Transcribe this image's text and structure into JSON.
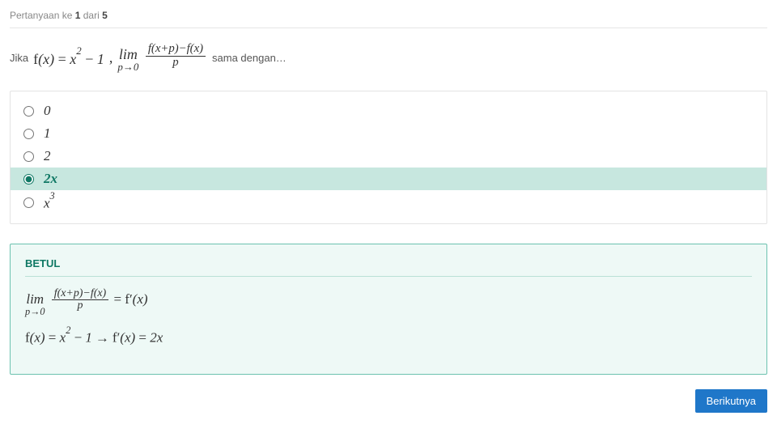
{
  "header": {
    "prefix": "Pertanyaan ke ",
    "current": "1",
    "sep": " dari ",
    "total": "5"
  },
  "question": {
    "lead": "Jika ",
    "expr_fx": "f(x) = x² − 1",
    "comma": ", ",
    "lim_word": "lim",
    "lim_sub": "p→0",
    "frac_num": "f(x+p)−f(x)",
    "frac_den": "p",
    "tail": " sama dengan…"
  },
  "options": [
    {
      "label": "0",
      "selected": false,
      "sup": ""
    },
    {
      "label": "1",
      "selected": false,
      "sup": ""
    },
    {
      "label": "2",
      "selected": false,
      "sup": ""
    },
    {
      "label": "2x",
      "selected": true,
      "sup": ""
    },
    {
      "label": "x",
      "selected": false,
      "sup": "3"
    }
  ],
  "feedback": {
    "title": "BETUL",
    "line1": {
      "lim_word": "lim",
      "lim_sub": "p→0",
      "frac_num": "f(x+p)−f(x)",
      "frac_den": "p",
      "eq": " = f′(x)"
    },
    "line2": "f(x) = x² − 1 → f′(x) = 2x"
  },
  "buttons": {
    "next": "Berikutnya"
  },
  "chart_data": {
    "type": "table",
    "question_number": 1,
    "total_questions": 5,
    "answer_options": [
      "0",
      "1",
      "2",
      "2x",
      "x^3"
    ],
    "correct_answer": "2x",
    "selected_answer": "2x",
    "result": "BETUL"
  }
}
